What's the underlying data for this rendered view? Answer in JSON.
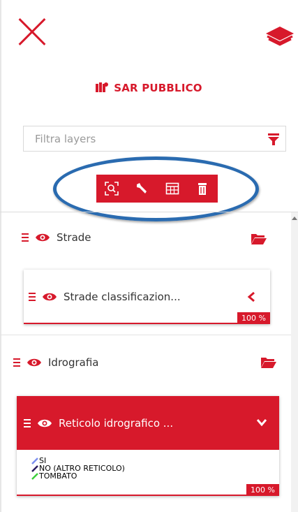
{
  "header": {
    "title": "SAR PUBBLICO",
    "icons": [
      "close-icon",
      "layers-icon",
      "map-icon"
    ]
  },
  "filter": {
    "placeholder": "Filtra layers",
    "value": ""
  },
  "toolbar": {
    "buttons": [
      "zoom-to-extent-icon",
      "wrench-icon",
      "table-icon",
      "trash-icon"
    ]
  },
  "layers": {
    "group1": {
      "name": "Strade"
    },
    "layer1": {
      "name": "Strade classificazion...",
      "opacity": "100 %"
    },
    "group2": {
      "name": "Idrografia"
    },
    "layer2": {
      "name": "Reticolo idrografico ...",
      "opacity": "100 %"
    }
  },
  "legend": [
    {
      "label": "SI",
      "color": "#7b8ef0"
    },
    {
      "label": "NO (ALTRO RETICOLO)",
      "color": "#2a1a5e"
    },
    {
      "label": "TOMBATO",
      "color": "#3ccf3c"
    }
  ],
  "colors": {
    "accent": "#d7192b",
    "highlight_oval": "#2a6bb0"
  }
}
